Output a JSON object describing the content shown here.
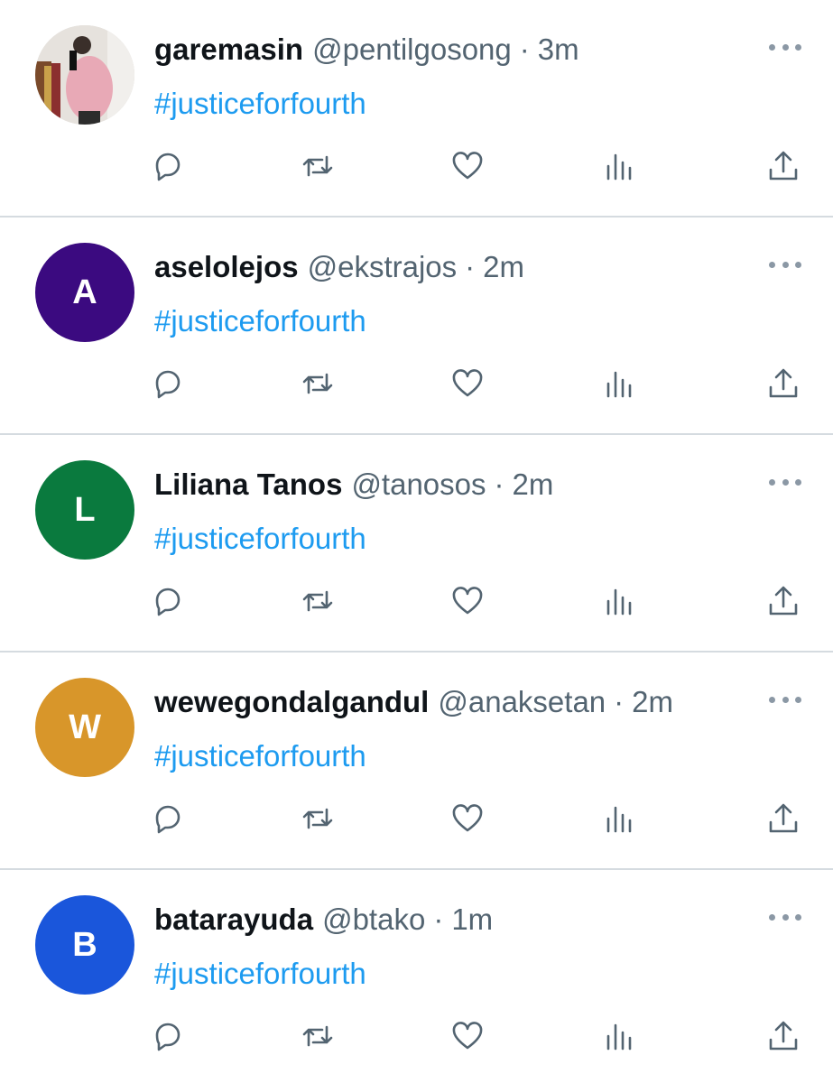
{
  "tweets": [
    {
      "name": "garemasin",
      "handle": "@pentilgosong",
      "separator": "·",
      "time": "3m",
      "text": "#justiceforfourth",
      "avatar": {
        "type": "photo",
        "initial": "",
        "color": "#d9d6d3"
      }
    },
    {
      "name": "aselolejos",
      "handle": "@ekstrajos",
      "separator": "·",
      "time": "2m",
      "text": "#justiceforfourth",
      "avatar": {
        "type": "initial",
        "initial": "A",
        "color": "#3b0a80"
      }
    },
    {
      "name": "Liliana Tanos",
      "handle": "@tanosos",
      "separator": "·",
      "time": "2m",
      "text": "#justiceforfourth",
      "avatar": {
        "type": "initial",
        "initial": "L",
        "color": "#0a7a3e"
      }
    },
    {
      "name": "wewegondalgandul",
      "handle": "@anaksetan",
      "separator": "·",
      "time": "2m",
      "text": "#justiceforfourth",
      "avatar": {
        "type": "initial",
        "initial": "W",
        "color": "#d8962a"
      }
    },
    {
      "name": "batarayuda",
      "handle": "@btako",
      "separator": "·",
      "time": "1m",
      "text": "#justiceforfourth",
      "avatar": {
        "type": "initial",
        "initial": "B",
        "color": "#1a56db"
      }
    }
  ],
  "icons": {
    "reply": "reply-icon",
    "retweet": "retweet-icon",
    "like": "heart-icon",
    "views": "views-icon",
    "share": "share-icon",
    "more": "more-icon"
  },
  "colors": {
    "hashtag": "#1d9bf0",
    "secondary_text": "#536471",
    "divider": "#d5dbe0"
  }
}
